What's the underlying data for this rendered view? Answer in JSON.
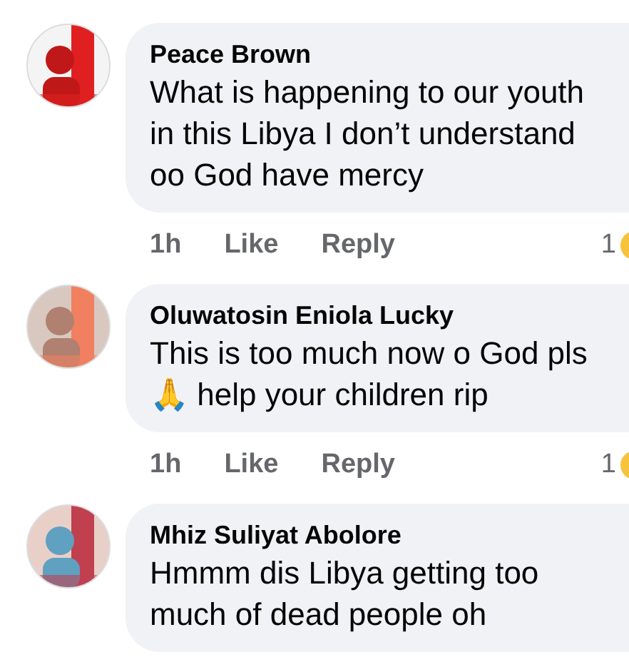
{
  "comments": [
    {
      "author": "Peace Brown",
      "body": "What is happening to our youth\nin this Libya I don’t understand\noo God have mercy",
      "time": "1h",
      "like": "Like",
      "reply": "Reply",
      "reactions": "1"
    },
    {
      "author": "Oluwatosin Eniola Lucky",
      "body": "This is too much now o God pls\n🙏 help your children rip",
      "time": "1h",
      "like": "Like",
      "reply": "Reply",
      "reactions": "1"
    },
    {
      "author": "Mhiz Suliyat Abolore",
      "body": "Hmmm dis Libya getting too\nmuch of dead people oh"
    }
  ]
}
